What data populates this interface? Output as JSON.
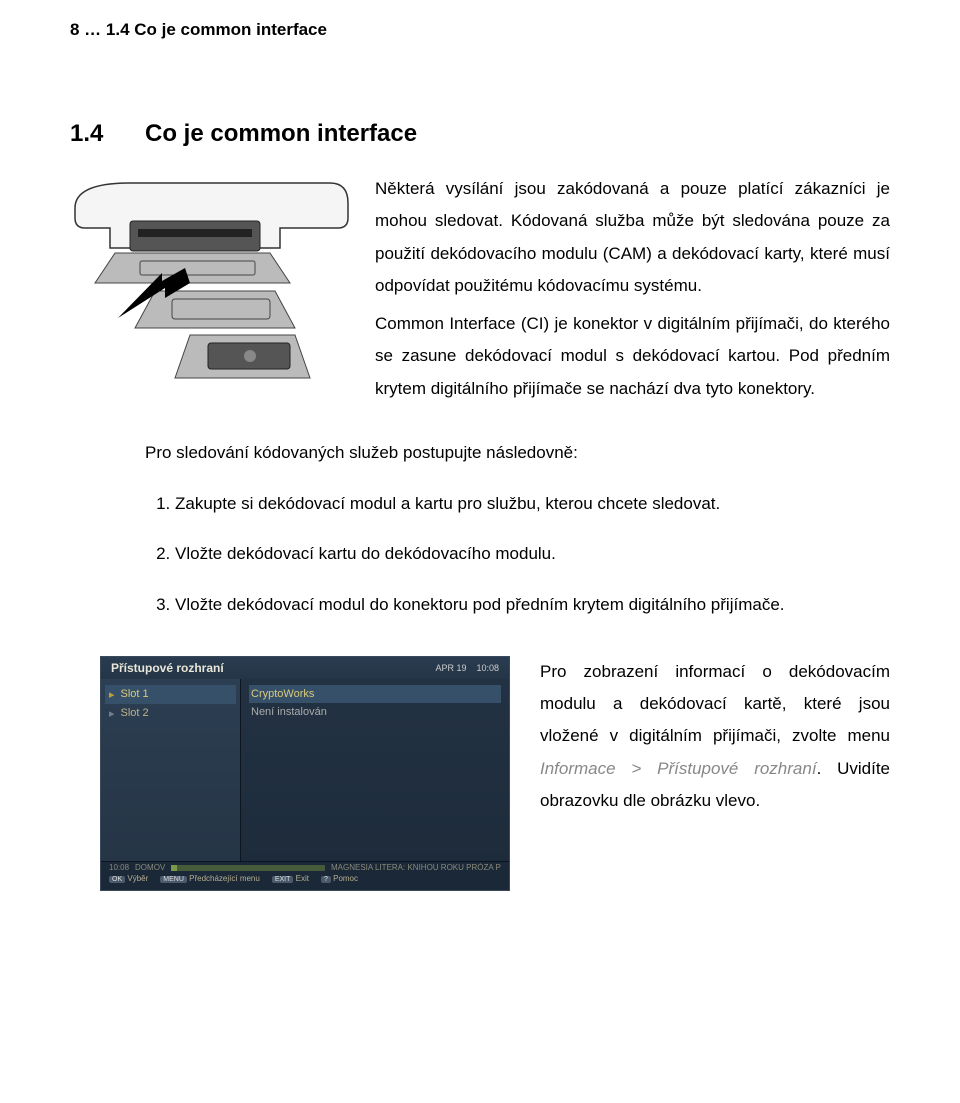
{
  "header": "8 … 1.4 Co je common interface",
  "section": {
    "number": "1.4",
    "title": "Co je common interface"
  },
  "intro": {
    "p1": "Některá vysílání jsou zakódovaná a pouze platící zákazníci je mohou sledovat. Kódovaná služba může být sledována pouze za použití dekódovacího modulu (CAM) a dekódovací karty, které musí odpovídat použitému kódovacímu systému.",
    "p2": "Common Interface (CI) je konektor v digitálním přijímači, do kterého se zasune dekódovací modul s dekódovací kartou. Pod předním krytem digitálního přijímače se nachází dva tyto konektory."
  },
  "steps_intro": "Pro sledování kódovaných služeb postupujte následovně:",
  "steps": [
    "Zakupte si dekódovací modul a kartu pro službu, kterou chcete sledovat.",
    "Vložte dekódovací kartu do dekódovacího modulu.",
    "Vložte dekódovací modul do konektoru pod předním krytem digitálního přijímače."
  ],
  "tvmenu": {
    "title": "Přístupové rozhraní",
    "date": "APR 19",
    "time": "10:08",
    "slot1": "Slot 1",
    "slot2": "Slot 2",
    "right1": "CryptoWorks",
    "right2": "Není instalován",
    "progress_time": "10:08",
    "progress_label": "DOMOV",
    "progress_title": "MAGNESIA LITERA: KNIHOU ROKU PRÓZA PETRY SOUKUPOVÉ ZMIZET",
    "btn_ok": "OK",
    "btn_ok_label": "Výběr",
    "btn_menu": "MENU",
    "btn_menu_label": "Předcházející menu",
    "btn_exit": "EXIT",
    "btn_exit_label": "Exit",
    "btn_help": "?",
    "btn_help_label": "Pomoc"
  },
  "bottom": {
    "text_pre": "Pro zobrazení informací o dekódovacím modulu a dekódovací kartě, které jsou vložené v digitálním přijímači, zvolte menu ",
    "menu_path": "Informace > Přístupové rozhraní",
    "text_post": ". Uvidíte obrazovku dle obrázku vlevo."
  }
}
